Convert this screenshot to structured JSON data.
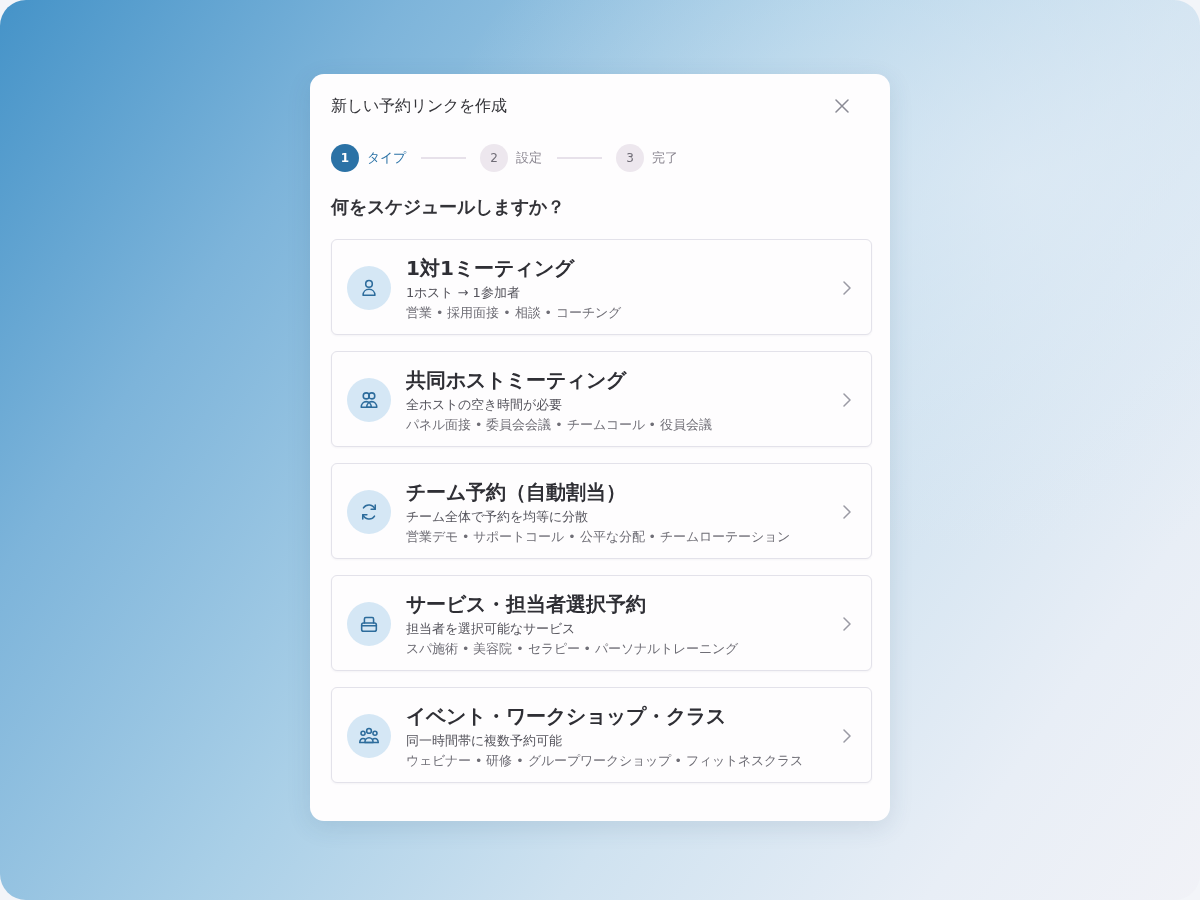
{
  "dialog": {
    "title": "新しい予約リンクを作成"
  },
  "steps": [
    {
      "number": "1",
      "label": "タイプ",
      "selected": true
    },
    {
      "number": "2",
      "label": "設定",
      "selected": false
    },
    {
      "number": "3",
      "label": "完了",
      "selected": false
    }
  ],
  "question": "何をスケジュールしますか？",
  "options": [
    {
      "kind": "one-on-one",
      "title": "1対1ミーティング",
      "subtitle": "1ホスト → 1参加者",
      "examples": "営業 • 採用面接 • 相談 • コーチング"
    },
    {
      "kind": "co-host",
      "title": "共同ホストミーティング",
      "subtitle": "全ホストの空き時間が必要",
      "examples": "パネル面接 • 委員会会議 • チームコール • 役員会議"
    },
    {
      "kind": "round-robin",
      "title": "チーム予約（自動割当）",
      "subtitle": "チーム全体で予約を均等に分散",
      "examples": "営業デモ • サポートコール • 公平な分配 • チームローテーション"
    },
    {
      "kind": "service",
      "title": "サービス・担当者選択予約",
      "subtitle": "担当者を選択可能なサービス",
      "examples": "スパ施術 • 美容院 • セラピー • パーソナルトレーニング"
    },
    {
      "kind": "group",
      "title": "イベント・ワークショップ・クラス",
      "subtitle": "同一時間帯に複数予約可能",
      "examples": "ウェビナー • 研修 • グループワークショップ • フィットネスクラス"
    }
  ]
}
